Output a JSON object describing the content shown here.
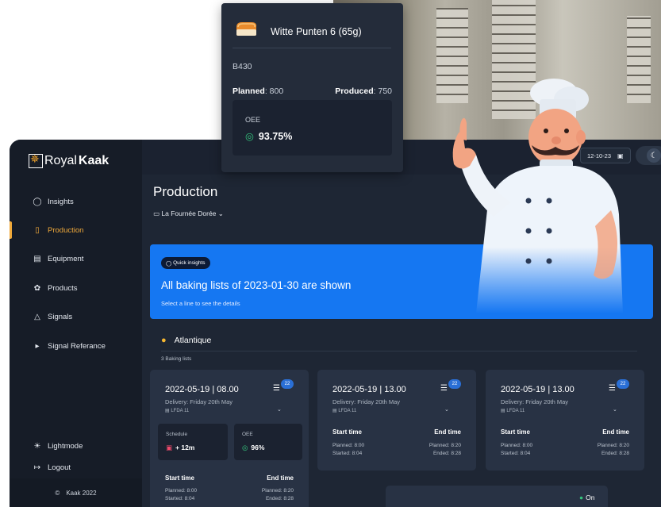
{
  "popup": {
    "product_name": "Witte Punten 6 (65g)",
    "code": "B430",
    "planned_label": "Planned",
    "planned_value": ": 800",
    "produced_label": "Produced",
    "produced_value": ": 750",
    "oee_label": "OEE",
    "oee_value": "93.75%"
  },
  "sidebar": {
    "brand_light": "Royal",
    "brand_bold": "Kaak",
    "items": [
      {
        "label": "Insights",
        "icon": "lightbulb-icon"
      },
      {
        "label": "Production",
        "icon": "bread-icon",
        "active": true
      },
      {
        "label": "Equipment",
        "icon": "equipment-icon"
      },
      {
        "label": "Products",
        "icon": "products-icon"
      },
      {
        "label": "Signals",
        "icon": "bell-icon"
      },
      {
        "label": "Signal Referance",
        "icon": "megaphone-icon"
      }
    ],
    "lightmode": "Lightmode",
    "logout": "Logout",
    "copyright": "Kaak 2022"
  },
  "topbar": {
    "date": "12-10-23"
  },
  "page": {
    "title": "Production",
    "location": "La Fournée Dorée"
  },
  "banner": {
    "badge": "Quick insights",
    "title": "All baking lists of 2023-01-30 are shown",
    "subtitle": "Select a line to see the details"
  },
  "section": {
    "name": "Atlantique",
    "sub": "3 Baking lists"
  },
  "cards": [
    {
      "date": "2022-05-19 | 08.00",
      "delivery": "Delivery: Friday 20th May",
      "line": "LFDA 11",
      "count": "22",
      "schedule_label": "Schedule",
      "schedule_value": "+ 12m",
      "oee_label": "OEE",
      "oee_value": "96%",
      "start_label": "Start time",
      "end_label": "End time",
      "planned_start": "Planned: 8:00",
      "started": "Started: 8:04",
      "planned_end": "Planned: 8:20",
      "ended": "Ended: 8:28"
    },
    {
      "date": "2022-05-19 | 13.00",
      "delivery": "Delivery: Friday 20th May",
      "line": "LFDA 11",
      "count": "22",
      "start_label": "Start time",
      "end_label": "End time",
      "planned_start": "Planned: 8:00",
      "started": "Started: 8:04",
      "planned_end": "Planned: 8:20",
      "ended": "Ended: 8:28"
    },
    {
      "date": "2022-05-19 | 13.00",
      "delivery": "Delivery: Friday 20th May",
      "line": "LFDA 11",
      "count": "22",
      "start_label": "Start time",
      "end_label": "End time",
      "planned_start": "Planned: 8:00",
      "started": "Started: 8:04",
      "planned_end": "Planned: 8:20",
      "ended": "Ended: 8:28"
    }
  ],
  "bottom_card": {
    "status": "On"
  },
  "colors": {
    "accent": "#f0a93a",
    "banner": "#1577f2",
    "success": "#34c27c",
    "danger": "#ef4a6b",
    "sidebar_bg": "#161c27",
    "main_bg": "#1e2634"
  }
}
